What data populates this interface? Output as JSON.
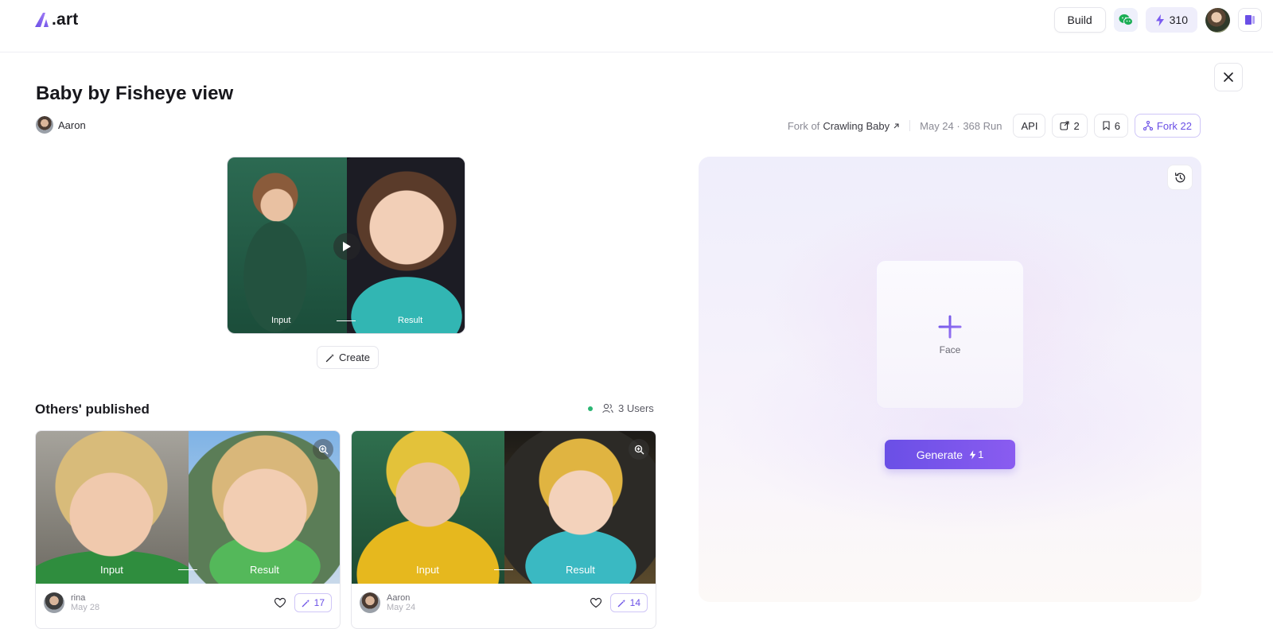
{
  "header": {
    "brand": ".art",
    "build_label": "Build",
    "credits": "310"
  },
  "title": "Baby by Fisheye view",
  "author": "Aaron",
  "meta": {
    "fork_of_prefix": "Fork of",
    "fork_of_name": "Crawling Baby",
    "date_runs": "May 24 · 368 Run",
    "api_label": "API",
    "shares": "2",
    "bookmarks": "6",
    "fork_label": "Fork 22"
  },
  "hero": {
    "input_label": "Input",
    "result_label": "Result",
    "create_label": "Create"
  },
  "published": {
    "title": "Others' published",
    "users": "3 Users",
    "cards": [
      {
        "input_label": "Input",
        "result_label": "Result",
        "user": "rina",
        "date": "May 28",
        "count": "17"
      },
      {
        "input_label": "Input",
        "result_label": "Result",
        "user": "Aaron",
        "date": "May 24",
        "count": "14"
      }
    ]
  },
  "panel": {
    "face_label": "Face",
    "generate_label": "Generate",
    "generate_cost": "1"
  },
  "colors": {
    "accent": "#6a4fe6",
    "online": "#2bb673"
  }
}
